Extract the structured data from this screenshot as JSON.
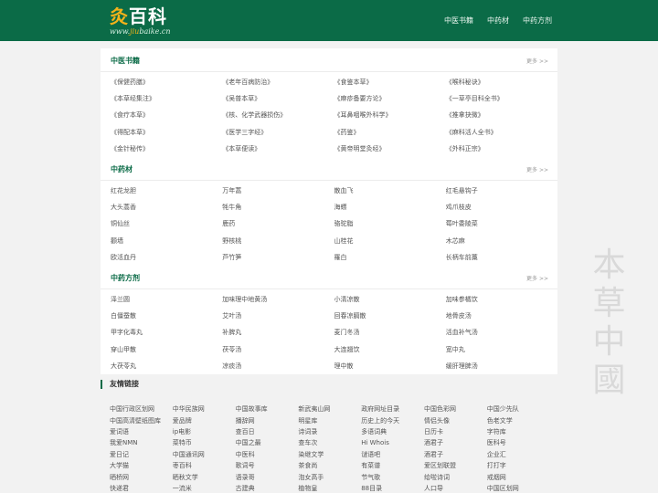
{
  "header": {
    "logo_accent": "灸",
    "logo_rest": "百科",
    "logo_sub_pre": "www.",
    "logo_sub_accent": "jiu",
    "logo_sub_post": "baike.cn",
    "nav": [
      "中医书籍",
      "中药材",
      "中药方剂"
    ]
  },
  "background_text": [
    "本",
    "草",
    "中",
    "國"
  ],
  "sections": [
    {
      "title": "中医书籍",
      "more": "更多 >>",
      "rows": [
        [
          "《保健药膳》",
          "《老年百病防治》",
          "《食鉴本草》",
          "《喉科秘诀》"
        ],
        [
          "《本草经集注》",
          "《吴普本草》",
          "《麻疹备要方论》",
          "《一草亭目科全书》"
        ],
        [
          "《食疗本草》",
          "《核、化学武器损伤》",
          "《耳鼻咽喉外科学》",
          "《推拿抉微》"
        ],
        [
          "《得配本草》",
          "《医学三字经》",
          "《药鉴》",
          "《麻科活人全书》"
        ],
        [
          "《金针秘传》",
          "《本草便读》",
          "《黄帝明堂灸经》",
          "《外科正宗》"
        ]
      ]
    },
    {
      "title": "中药材",
      "more": "更多 >>",
      "rows": [
        [
          "红花龙胆",
          "万年蒿",
          "散血飞",
          "红毛悬钩子"
        ],
        [
          "大头蒿香",
          "牦牛角",
          "海螵",
          "鸡爪枝皮"
        ],
        [
          "铜仙丝",
          "鹿药",
          "骆驼脂",
          "莓叶委陵菜"
        ],
        [
          "颧墙",
          "野核桃",
          "山桂花",
          "木芯麻"
        ],
        [
          "欧活血丹",
          "芦竹笋",
          "羅白",
          "长柄车前藁"
        ]
      ]
    },
    {
      "title": "中药方剂",
      "more": "更多 >>",
      "rows": [
        [
          "泽兰圆",
          "加味理中地黄汤",
          "小清凉散",
          "加味参橘饮"
        ],
        [
          "白僵蚕散",
          "艾叶汤",
          "回春凉膈散",
          "地骨皮汤"
        ],
        [
          "甲字化毒丸",
          "补脾丸",
          "麦门冬汤",
          "活血补气汤"
        ],
        [
          "穿山甲散",
          "茯苓汤",
          "大连翘饮",
          "宽中丸"
        ],
        [
          "大茯苓丸",
          "凉痰汤",
          "理中散",
          "缓肝理脾汤"
        ]
      ]
    }
  ],
  "friend_links": {
    "title": "友情链接",
    "rows": [
      [
        "中国行政区划网",
        "中华民族网",
        "中国故事库",
        "新武夷山网",
        "政府网址目录",
        "中国色彩网",
        "中国少先队"
      ],
      [
        "中国高清壁纸图库",
        "爱品牌",
        "播辞网",
        "明星库",
        "历史上的今天",
        "情侣头像",
        "色老文学"
      ],
      [
        "爱词语",
        "ip电影",
        "查百日",
        "诗词录",
        "多语词典",
        "日历卡",
        "字符库"
      ],
      [
        "我爱NMN",
        "菜特币",
        "中国之最",
        "查车次",
        "Hi Whois",
        "酒君子",
        "医科号"
      ],
      [
        "爱日记",
        "中国通讯网",
        "中医科",
        "染继文学",
        "谜语吧",
        "酒君子",
        "企业汇"
      ],
      [
        "大学猫",
        "枣百科",
        "歌词号",
        "茶食尚",
        "有菜谱",
        "爱区划联盟",
        "打打字"
      ],
      [
        "晒桥网",
        "晒秋文学",
        "语录哥",
        "泡女高手",
        "节气歌",
        "给啦诗词",
        "戒烟网"
      ],
      [
        "快递君",
        "一流米",
        "古建典",
        "植物皇",
        "88目录",
        "人口导",
        "中国区划网"
      ]
    ]
  }
}
